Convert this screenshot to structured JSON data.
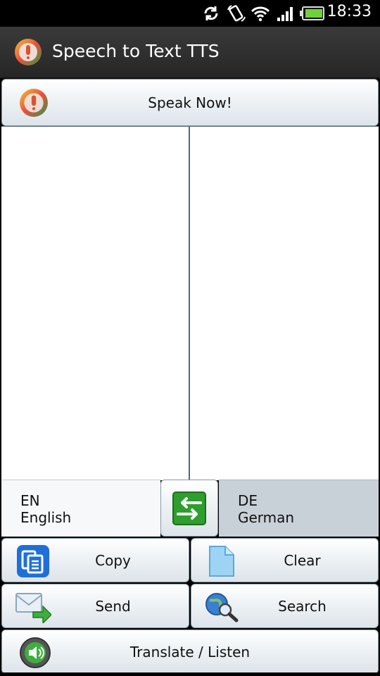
{
  "status_bar": {
    "time": "18:33"
  },
  "app": {
    "title": "Speech to Text TTS"
  },
  "speak_button": {
    "label": "Speak Now!"
  },
  "source_text": "",
  "target_text": "",
  "languages": {
    "source": {
      "code": "EN",
      "name": "English"
    },
    "target": {
      "code": "DE",
      "name": "German"
    }
  },
  "actions": {
    "copy": "Copy",
    "clear": "Clear",
    "send": "Send",
    "search": "Search",
    "translate_listen": "Translate / Listen"
  },
  "colors": {
    "title_bg": "#2f2f2f",
    "swap_green": "#2e9e2e",
    "copy_blue": "#1e6fd9",
    "clear_blue": "#8cc8ef"
  }
}
